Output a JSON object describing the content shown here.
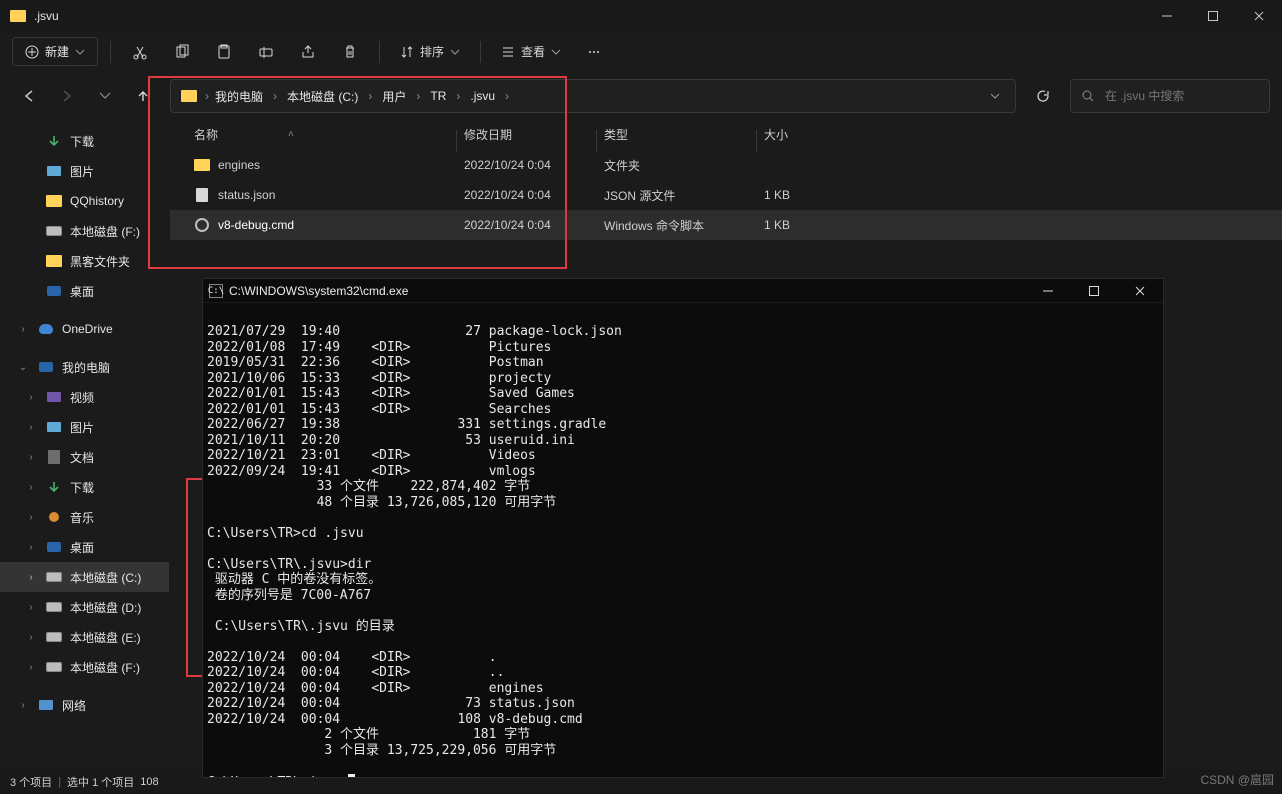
{
  "title": ".jsvu",
  "toolbar": {
    "new_label": "新建",
    "sort_label": "排序",
    "view_label": "查看"
  },
  "breadcrumb": [
    "我的电脑",
    "本地磁盘 (C:)",
    "用户",
    "TR",
    ".jsvu"
  ],
  "search_placeholder": "在 .jsvu 中搜索",
  "columns": {
    "name": "名称",
    "modified": "修改日期",
    "type": "类型",
    "size": "大小"
  },
  "rows": [
    {
      "icon": "folder",
      "name": "engines",
      "modified": "2022/10/24 0:04",
      "type": "文件夹",
      "size": ""
    },
    {
      "icon": "file",
      "name": "status.json",
      "modified": "2022/10/24 0:04",
      "type": "JSON 源文件",
      "size": "1 KB"
    },
    {
      "icon": "gear",
      "name": "v8-debug.cmd",
      "modified": "2022/10/24 0:04",
      "type": "Windows 命令脚本",
      "size": "1 KB",
      "selected": true
    }
  ],
  "sidebar": [
    {
      "icon": "down",
      "label": "下载",
      "level": 1,
      "color": "#49b36b"
    },
    {
      "icon": "pic",
      "label": "图片",
      "level": 1
    },
    {
      "icon": "folder",
      "label": "QQhistory",
      "level": 1
    },
    {
      "icon": "drive",
      "label": "本地磁盘 (F:)",
      "level": 1
    },
    {
      "icon": "folder",
      "label": "黑客文件夹",
      "level": 1
    },
    {
      "icon": "monitor",
      "label": "桌面",
      "level": 1,
      "bluebg": true
    },
    {
      "spacer": true
    },
    {
      "icon": "cloud",
      "label": "OneDrive",
      "expand": ">",
      "level": 0
    },
    {
      "spacer": true
    },
    {
      "icon": "monitor",
      "label": "我的电脑",
      "expand": "v",
      "level": 0
    },
    {
      "icon": "purple",
      "label": "视频",
      "expand": ">",
      "level": 1
    },
    {
      "icon": "pic",
      "label": "图片",
      "expand": ">",
      "level": 1
    },
    {
      "icon": "doc",
      "label": "文档",
      "expand": ">",
      "level": 1
    },
    {
      "icon": "down",
      "label": "下载",
      "expand": ">",
      "level": 1,
      "color": "#49b36b"
    },
    {
      "icon": "orange",
      "label": "音乐",
      "expand": ">",
      "level": 1
    },
    {
      "icon": "monitor",
      "label": "桌面",
      "expand": ">",
      "level": 1
    },
    {
      "icon": "drive",
      "label": "本地磁盘 (C:)",
      "expand": ">",
      "level": 1,
      "selected": true
    },
    {
      "icon": "drive",
      "label": "本地磁盘 (D:)",
      "expand": ">",
      "level": 1
    },
    {
      "icon": "drive",
      "label": "本地磁盘 (E:)",
      "expand": ">",
      "level": 1
    },
    {
      "icon": "drive",
      "label": "本地磁盘 (F:)",
      "expand": ">",
      "level": 1
    },
    {
      "spacer": true
    },
    {
      "icon": "blue",
      "label": "网络",
      "expand": ">",
      "level": 0
    }
  ],
  "status": {
    "items": "3 个项目",
    "selection": "选中 1 个项目",
    "size": "108"
  },
  "cmd": {
    "title": "C:\\WINDOWS\\system32\\cmd.exe",
    "text": "2021/07/29  19:40                27 package-lock.json\n2022/01/08  17:49    <DIR>          Pictures\n2019/05/31  22:36    <DIR>          Postman\n2021/10/06  15:33    <DIR>          projecty\n2022/01/01  15:43    <DIR>          Saved Games\n2022/01/01  15:43    <DIR>          Searches\n2022/06/27  19:38               331 settings.gradle\n2021/10/11  20:20                53 useruid.ini\n2022/10/21  23:01    <DIR>          Videos\n2022/09/24  19:41    <DIR>          vmlogs\n              33 个文件    222,874,402 字节\n              48 个目录 13,726,085,120 可用字节\n\nC:\\Users\\TR>cd .jsvu\n\nC:\\Users\\TR\\.jsvu>dir\n 驱动器 C 中的卷没有标签。\n 卷的序列号是 7C00-A767\n\n C:\\Users\\TR\\.jsvu 的目录\n\n2022/10/24  00:04    <DIR>          .\n2022/10/24  00:04    <DIR>          ..\n2022/10/24  00:04    <DIR>          engines\n2022/10/24  00:04                73 status.json\n2022/10/24  00:04               108 v8-debug.cmd\n               2 个文件            181 字节\n               3 个目录 13,725,229,056 可用字节\n\nC:\\Users\\TR\\.jsvu>"
  },
  "watermark": "CSDN @扈园"
}
